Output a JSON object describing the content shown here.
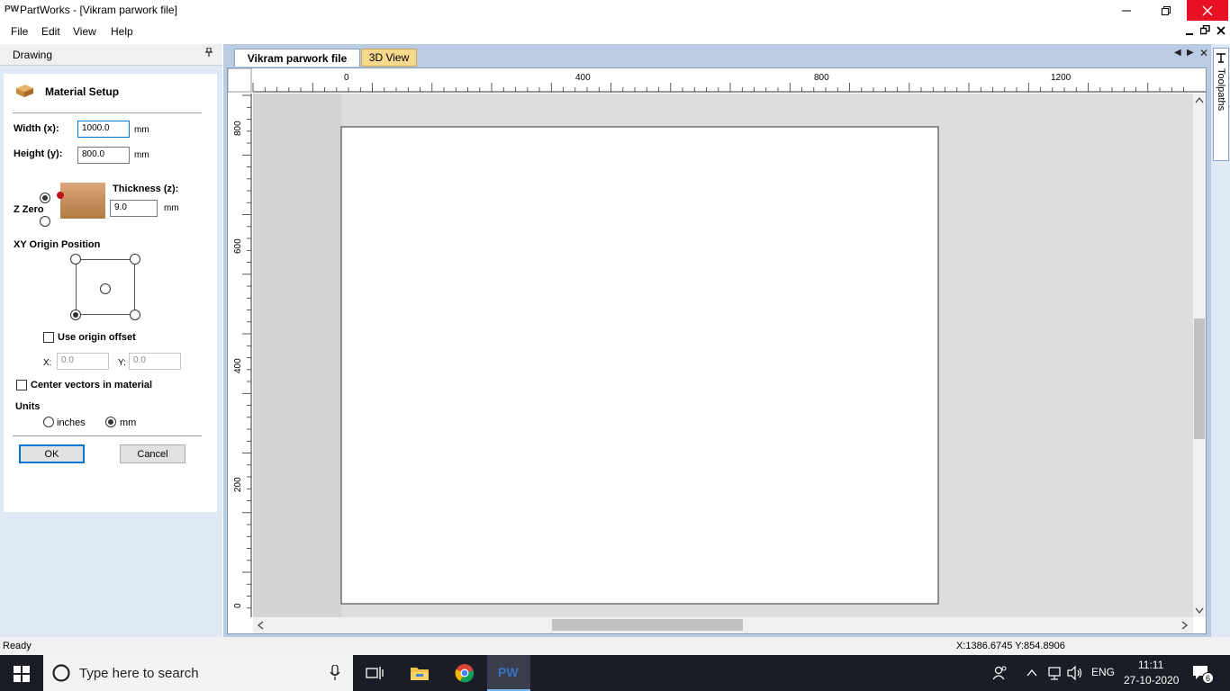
{
  "window": {
    "logo": "PW",
    "title": "PartWorks - [Vikram parwork file]"
  },
  "menu": [
    "File",
    "Edit",
    "View",
    "Help"
  ],
  "panel": {
    "title": "Drawing",
    "section_title": "Material Setup",
    "width_label": "Width (x):",
    "width_value": "1000.0",
    "height_label": "Height (y):",
    "height_value": "800.0",
    "unit": "mm",
    "thickness_label": "Thickness (z):",
    "thickness_value": "9.0",
    "z_zero_label": "Z Zero",
    "xy_origin_label": "XY Origin Position",
    "use_origin_offset_label": "Use origin offset",
    "x_label": "X:",
    "x_value": "0.0",
    "y_label": "Y:",
    "y_value": "0.0",
    "center_vectors_label": "Center vectors in material",
    "units_label": "Units",
    "inches_label": "inches",
    "mm_label": "mm",
    "ok_label": "OK",
    "cancel_label": "Cancel"
  },
  "tabs": {
    "active": "Vikram parwork file",
    "inactive": "3D View"
  },
  "ruler": {
    "h_labels": [
      "0",
      "400",
      "800",
      "1200"
    ],
    "v_labels": [
      "800",
      "600",
      "400",
      "200",
      "0"
    ]
  },
  "side_tab": "Toolpaths",
  "status": {
    "left": "Ready",
    "coords": "X:1386.6745 Y:854.8906"
  },
  "taskbar": {
    "search_placeholder": "Type here to search",
    "lang": "ENG",
    "time": "11:11",
    "date": "27-10-2020",
    "notification_count": "6",
    "app_label": "PW"
  },
  "colors": {
    "panel_bg": "#dfe8f5",
    "doc_bg": "#bccbe4",
    "tab_inactive": "#f7d98e",
    "close_red": "#e81123",
    "taskbar": "#1a1d26"
  }
}
